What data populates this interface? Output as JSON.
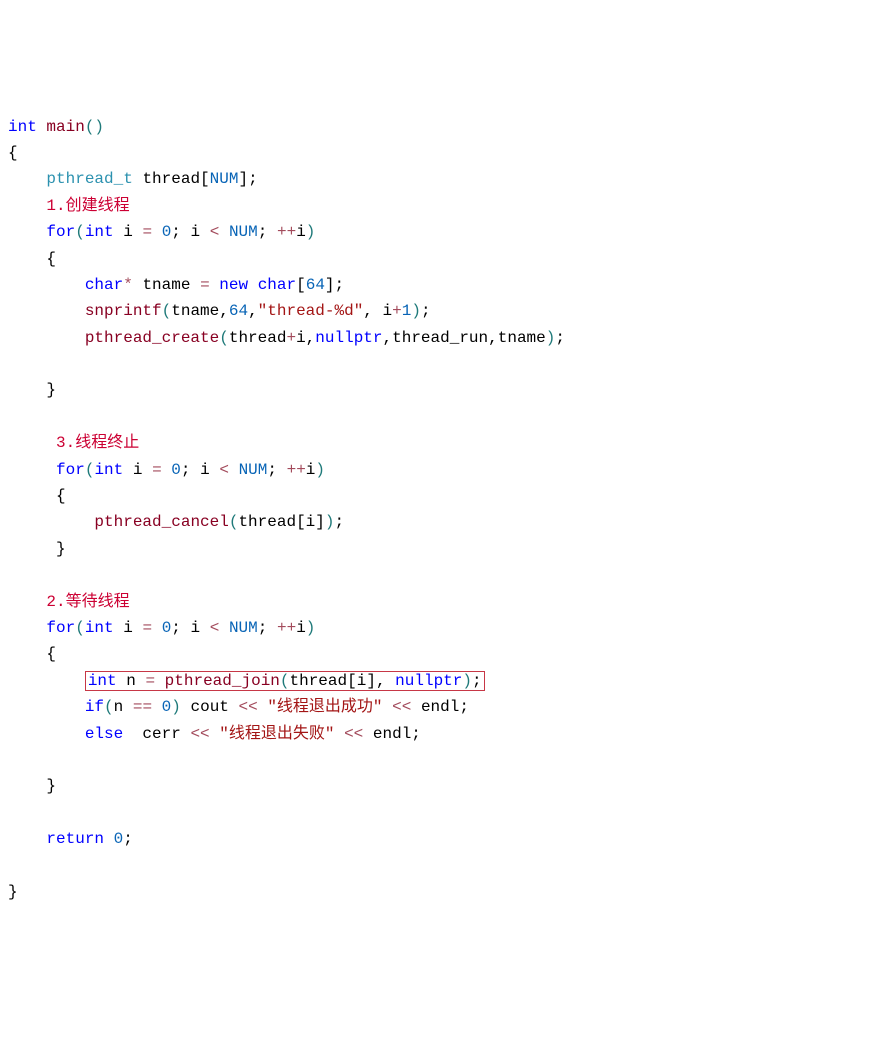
{
  "code": {
    "l1": {
      "kw_int": "int",
      "func_main": "main",
      "paren": "()"
    },
    "l2": {
      "open": "{"
    },
    "l3": {
      "type": "pthread_t",
      "var": "thread",
      "bracket_open": "[",
      "const": "NUM",
      "bracket_close": "]",
      "semi": ";"
    },
    "l4": {
      "comment": "1.创建线程"
    },
    "l5": {
      "for": "for",
      "paren_open": "(",
      "int": "int",
      "var_i": "i",
      "eq": "=",
      "zero": "0",
      "semi1": ";",
      "var_i2": "i",
      "lt": "<",
      "num": "NUM",
      "semi2": ";",
      "inc": "++",
      "var_i3": "i",
      "paren_close": ")"
    },
    "l6": {
      "open": "{"
    },
    "l7": {
      "char": "char",
      "star": "*",
      "var": "tname",
      "eq": "=",
      "new_kw": "new",
      "char2": "char",
      "bracket_open": "[",
      "sixtyfour": "64",
      "bracket_close": "]",
      "semi": ";"
    },
    "l8": {
      "func": "snprintf",
      "paren_open": "(",
      "arg1": "tname",
      "comma1": ",",
      "arg2": "64",
      "comma2": ",",
      "str": "\"thread-%d\"",
      "comma3": ",",
      "arg_i": "i",
      "plus": "+",
      "one": "1",
      "paren_close": ")",
      "semi": ";"
    },
    "l9": {
      "func": "pthread_create",
      "paren_open": "(",
      "arg1": "thread",
      "plus": "+",
      "arg_i": "i",
      "comma1": ",",
      "nullptr1": "nullptr",
      "comma2": ",",
      "arg3": "thread_run",
      "comma3": ",",
      "arg4": "tname",
      "paren_close": ")",
      "semi": ";"
    },
    "l10": {
      "close": "}"
    },
    "l11": {
      "comment": "3.线程终止"
    },
    "l12": {
      "for": "for",
      "paren_open": "(",
      "int": "int",
      "var_i": "i",
      "eq": "=",
      "zero": "0",
      "semi1": ";",
      "var_i2": "i",
      "lt": "<",
      "num": "NUM",
      "semi2": ";",
      "inc": "++",
      "var_i3": "i",
      "paren_close": ")"
    },
    "l13": {
      "open": "{"
    },
    "l14": {
      "func": "pthread_cancel",
      "paren_open": "(",
      "arg1": "thread",
      "bracket_open": "[",
      "arg_i": "i",
      "bracket_close": "]",
      "paren_close": ")",
      "semi": ";"
    },
    "l15": {
      "close": "}"
    },
    "l16": {
      "comment": "2.等待线程"
    },
    "l17": {
      "for": "for",
      "paren_open": "(",
      "int": "int",
      "var_i": "i",
      "eq": "=",
      "zero": "0",
      "semi1": ";",
      "var_i2": "i",
      "lt": "<",
      "num": "NUM",
      "semi2": ";",
      "inc": "++",
      "var_i3": "i",
      "paren_close": ")"
    },
    "l18": {
      "open": "{"
    },
    "l19": {
      "int": "int",
      "var_n": "n",
      "eq": "=",
      "func": "pthread_join",
      "paren_open": "(",
      "arg1": "thread",
      "bracket_open": "[",
      "arg_i": "i",
      "bracket_close": "]",
      "comma": ",",
      "nullptr1": "nullptr",
      "paren_close": ")",
      "semi": ";"
    },
    "l20": {
      "if": "if",
      "paren_open": "(",
      "var_n": "n",
      "eqeq": "==",
      "zero": "0",
      "paren_close": ")",
      "cout": "cout",
      "lshift1": "<<",
      "str": "\"线程退出成功\"",
      "lshift2": "<<",
      "endl": "endl",
      "semi": ";"
    },
    "l21": {
      "else": "else",
      "cerr": "cerr",
      "lshift1": "<<",
      "str": "\"线程退出失败\"",
      "lshift2": "<<",
      "endl": "endl",
      "semi": ";"
    },
    "l22": {
      "close": "}"
    },
    "l23": {
      "return": "return",
      "zero": "0",
      "semi": ";"
    },
    "l24": {
      "close": "}"
    }
  }
}
